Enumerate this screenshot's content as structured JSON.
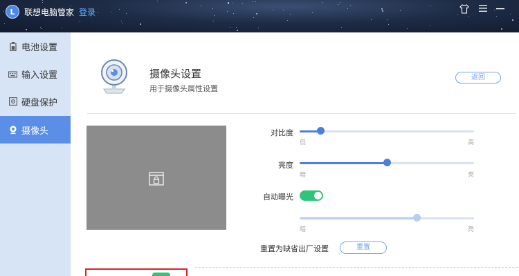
{
  "titlebar": {
    "logo_letter": "L",
    "app_title": "联想电脑管家",
    "login_label": "登录",
    "shirt_icon": "⇧",
    "menu_icon": "☰",
    "minimize_icon": "—"
  },
  "sidebar": {
    "items": [
      {
        "label": "电池设置",
        "icon": "battery-icon"
      },
      {
        "label": "输入设置",
        "icon": "keyboard-icon"
      },
      {
        "label": "硬盘保护",
        "icon": "disk-icon"
      },
      {
        "label": "摄像头",
        "icon": "camera-icon",
        "active": true
      }
    ]
  },
  "header": {
    "title": "摄像头设置",
    "subtitle": "用于摄像头属性设置",
    "back_label": "返回"
  },
  "controls": {
    "contrast": {
      "label": "对比度",
      "min_label": "低",
      "max_label": "高",
      "value": 0.12
    },
    "brightness": {
      "label": "亮度",
      "min_label": "暗",
      "max_label": "亮",
      "value": 0.5
    },
    "auto_exposure": {
      "label": "自动曝光",
      "on": true
    },
    "exposure": {
      "min_label": "暗",
      "max_label": "亮",
      "value": 0.67
    },
    "reset": {
      "label": "重置为缺省出厂设置",
      "button_label": "重置"
    }
  },
  "colors": {
    "accent": "#4a7fdc",
    "sidebar_bg": "#d7e4f6",
    "sidebar_active": "#5b8ee6",
    "toggle_on": "#2ec57a",
    "highlight_red": "#e02020"
  }
}
